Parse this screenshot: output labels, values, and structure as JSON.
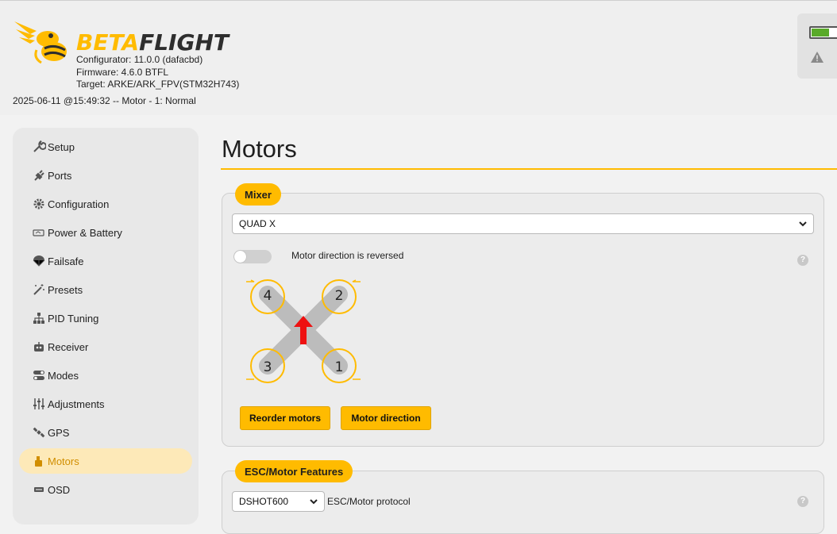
{
  "brand": {
    "logo_part1": "BETA",
    "logo_part2": "FLIGHT",
    "accent": "#ffbb00"
  },
  "info": {
    "configurator": "Configurator: 11.0.0 (dafacbd)",
    "firmware": "Firmware: 4.6.0 BTFL",
    "target": "Target: ARKE/ARK_FPV(STM32H743)"
  },
  "status_line": "2025-06-11 @15:49:32 -- Motor - 1: Normal",
  "sidebar": {
    "items": [
      {
        "label": "Setup",
        "icon": "wrench-icon"
      },
      {
        "label": "Ports",
        "icon": "plug-icon"
      },
      {
        "label": "Configuration",
        "icon": "gear-icon"
      },
      {
        "label": "Power & Battery",
        "icon": "battery-icon"
      },
      {
        "label": "Failsafe",
        "icon": "parachute-icon"
      },
      {
        "label": "Presets",
        "icon": "magic-wand-icon"
      },
      {
        "label": "PID Tuning",
        "icon": "sitemap-icon"
      },
      {
        "label": "Receiver",
        "icon": "robot-icon"
      },
      {
        "label": "Modes",
        "icon": "toggle-icon"
      },
      {
        "label": "Adjustments",
        "icon": "sliders-icon"
      },
      {
        "label": "GPS",
        "icon": "satellite-icon"
      },
      {
        "label": "Motors",
        "icon": "motor-icon",
        "active": true
      },
      {
        "label": "OSD",
        "icon": "osd-icon"
      }
    ]
  },
  "main": {
    "title": "Motors",
    "mixer": {
      "label": "Mixer",
      "selected": "QUAD X",
      "toggle_label": "Motor direction is reversed",
      "toggle_on": false,
      "motors": [
        "4",
        "2",
        "3",
        "1"
      ],
      "buttons": {
        "reorder": "Reorder motors",
        "direction": "Motor direction"
      }
    },
    "esc": {
      "label": "ESC/Motor Features",
      "protocol": "DSHOT600",
      "protocol_label": "ESC/Motor protocol"
    }
  }
}
